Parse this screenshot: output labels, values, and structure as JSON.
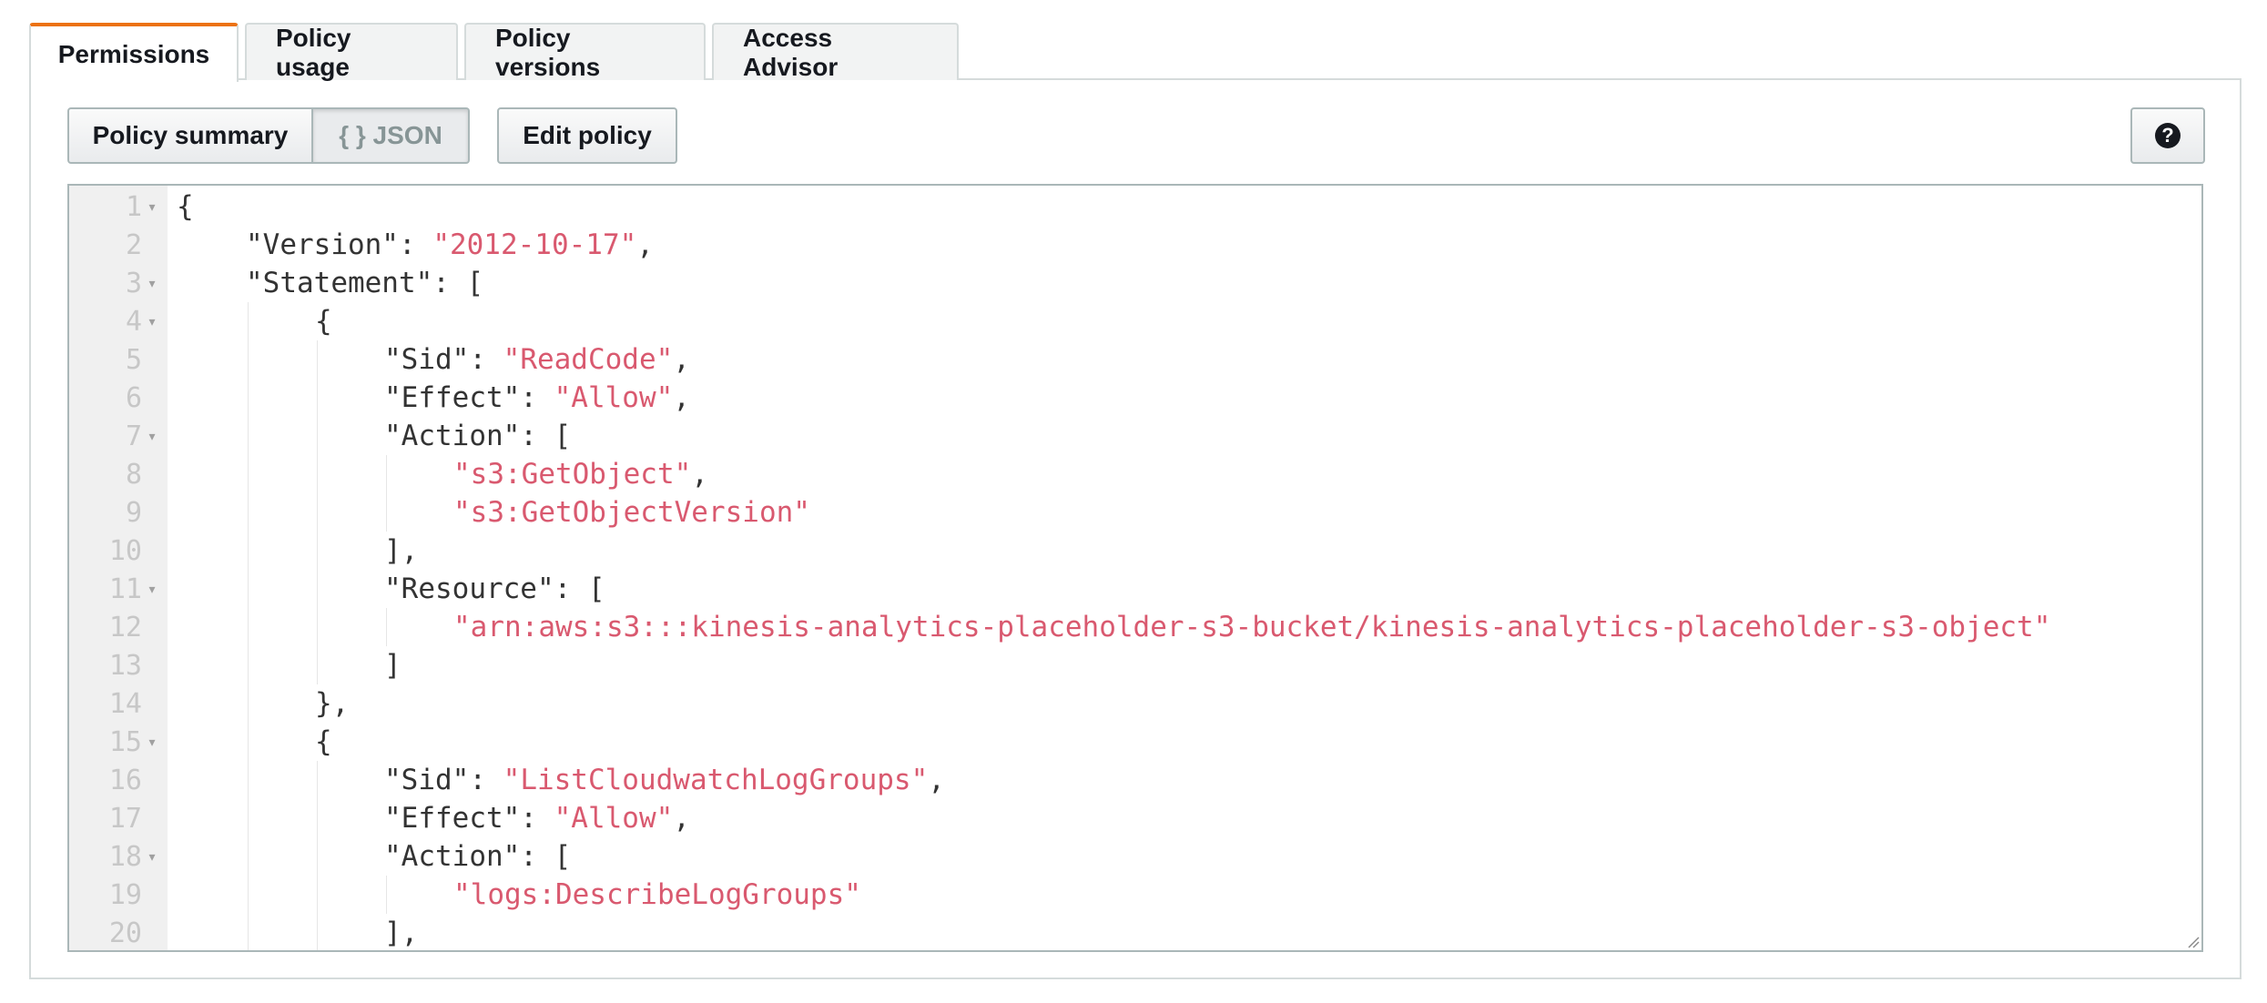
{
  "tabs": [
    {
      "label": "Permissions",
      "active": true
    },
    {
      "label": "Policy usage",
      "active": false
    },
    {
      "label": "Policy versions",
      "active": false
    },
    {
      "label": "Access Advisor",
      "active": false
    }
  ],
  "toolbar": {
    "policy_summary_label": "Policy summary",
    "json_label": "{ } JSON",
    "edit_policy_label": "Edit policy",
    "help_icon": "question-circle-icon"
  },
  "editor": {
    "lines": [
      {
        "n": "1",
        "fold": true,
        "indent": 0,
        "parts": [
          {
            "t": "{",
            "s": false
          }
        ]
      },
      {
        "n": "2",
        "fold": false,
        "indent": 1,
        "parts": [
          {
            "t": "\"Version\": ",
            "s": false
          },
          {
            "t": "\"2012-10-17\"",
            "s": true
          },
          {
            "t": ",",
            "s": false
          }
        ]
      },
      {
        "n": "3",
        "fold": true,
        "indent": 1,
        "parts": [
          {
            "t": "\"Statement\": [",
            "s": false
          }
        ]
      },
      {
        "n": "4",
        "fold": true,
        "indent": 2,
        "parts": [
          {
            "t": "{",
            "s": false
          }
        ]
      },
      {
        "n": "5",
        "fold": false,
        "indent": 3,
        "parts": [
          {
            "t": "\"Sid\": ",
            "s": false
          },
          {
            "t": "\"ReadCode\"",
            "s": true
          },
          {
            "t": ",",
            "s": false
          }
        ]
      },
      {
        "n": "6",
        "fold": false,
        "indent": 3,
        "parts": [
          {
            "t": "\"Effect\": ",
            "s": false
          },
          {
            "t": "\"Allow\"",
            "s": true
          },
          {
            "t": ",",
            "s": false
          }
        ]
      },
      {
        "n": "7",
        "fold": true,
        "indent": 3,
        "parts": [
          {
            "t": "\"Action\": [",
            "s": false
          }
        ]
      },
      {
        "n": "8",
        "fold": false,
        "indent": 4,
        "parts": [
          {
            "t": "\"s3:GetObject\"",
            "s": true
          },
          {
            "t": ",",
            "s": false
          }
        ]
      },
      {
        "n": "9",
        "fold": false,
        "indent": 4,
        "parts": [
          {
            "t": "\"s3:GetObjectVersion\"",
            "s": true
          }
        ]
      },
      {
        "n": "10",
        "fold": false,
        "indent": 3,
        "parts": [
          {
            "t": "],",
            "s": false
          }
        ]
      },
      {
        "n": "11",
        "fold": true,
        "indent": 3,
        "parts": [
          {
            "t": "\"Resource\": [",
            "s": false
          }
        ]
      },
      {
        "n": "12",
        "fold": false,
        "indent": 4,
        "parts": [
          {
            "t": "\"arn:aws:s3:::kinesis-analytics-placeholder-s3-bucket/kinesis-analytics-placeholder-s3-object\"",
            "s": true
          }
        ]
      },
      {
        "n": "13",
        "fold": false,
        "indent": 3,
        "parts": [
          {
            "t": "]",
            "s": false
          }
        ]
      },
      {
        "n": "14",
        "fold": false,
        "indent": 2,
        "parts": [
          {
            "t": "},",
            "s": false
          }
        ]
      },
      {
        "n": "15",
        "fold": true,
        "indent": 2,
        "parts": [
          {
            "t": "{",
            "s": false
          }
        ]
      },
      {
        "n": "16",
        "fold": false,
        "indent": 3,
        "parts": [
          {
            "t": "\"Sid\": ",
            "s": false
          },
          {
            "t": "\"ListCloudwatchLogGroups\"",
            "s": true
          },
          {
            "t": ",",
            "s": false
          }
        ]
      },
      {
        "n": "17",
        "fold": false,
        "indent": 3,
        "parts": [
          {
            "t": "\"Effect\": ",
            "s": false
          },
          {
            "t": "\"Allow\"",
            "s": true
          },
          {
            "t": ",",
            "s": false
          }
        ]
      },
      {
        "n": "18",
        "fold": true,
        "indent": 3,
        "parts": [
          {
            "t": "\"Action\": [",
            "s": false
          }
        ]
      },
      {
        "n": "19",
        "fold": false,
        "indent": 4,
        "parts": [
          {
            "t": "\"logs:DescribeLogGroups\"",
            "s": true
          }
        ]
      },
      {
        "n": "20",
        "fold": false,
        "indent": 3,
        "parts": [
          {
            "t": "],",
            "s": false
          }
        ]
      }
    ]
  },
  "colors": {
    "active_tab_accent": "#ec7211",
    "string": "#d9596f",
    "punctuation": "#333333",
    "line_number": "#c7c7c7"
  }
}
